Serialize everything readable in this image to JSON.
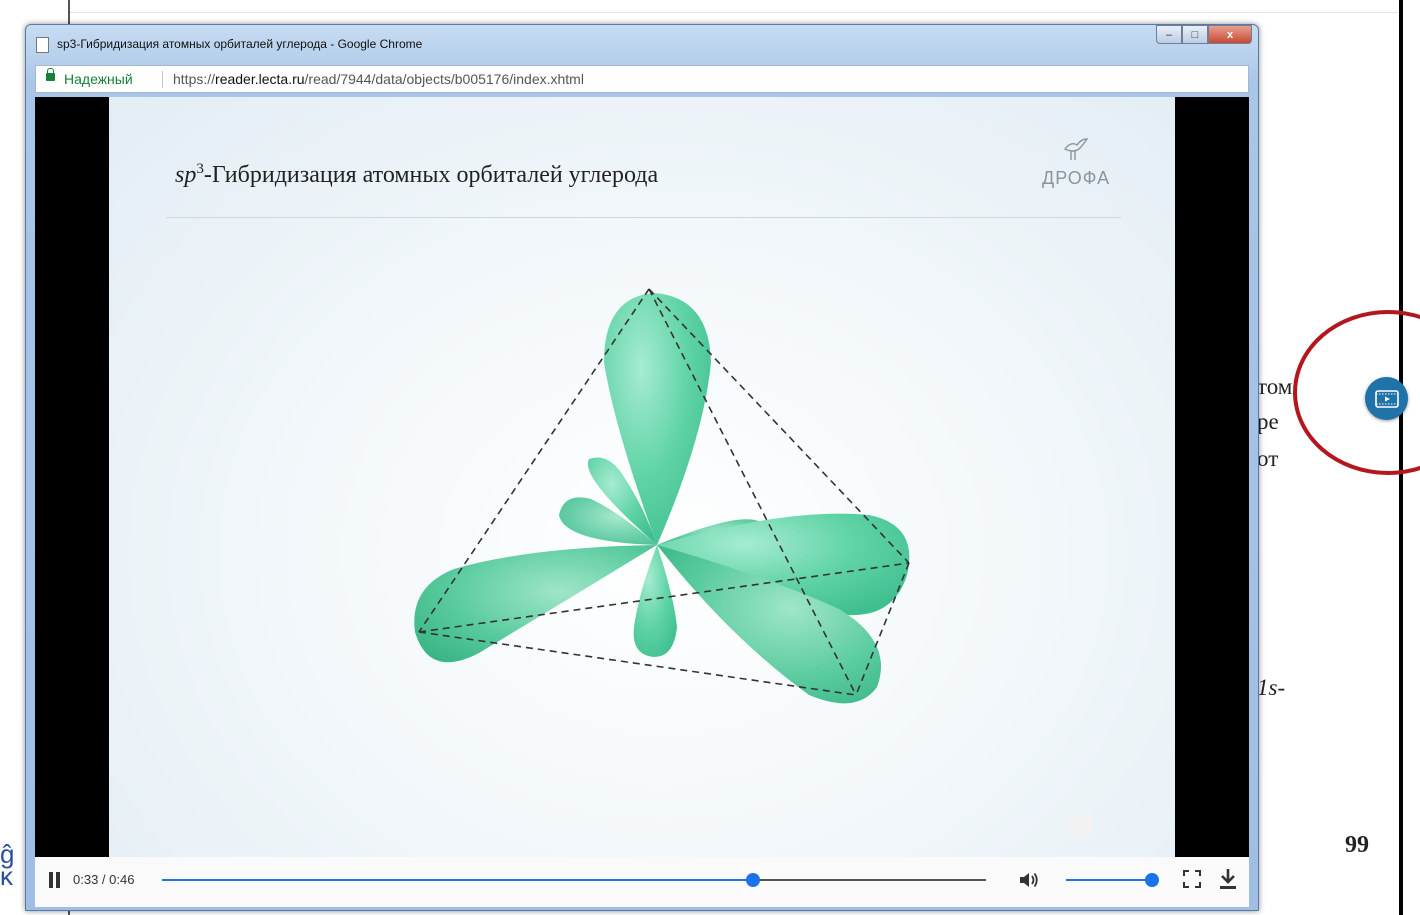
{
  "window": {
    "title": "sp3-Гибридизация атомных орбиталей углерода - Google Chrome",
    "buttons": {
      "minimize": "–",
      "maximize": "□",
      "close": "x"
    }
  },
  "address_bar": {
    "secure_label": "Надежный",
    "url_scheme": "https://",
    "url_host": "reader.lecta.ru",
    "url_path": "/read/7944/data/objects/b005176/index.xhtml"
  },
  "slide": {
    "title_prefix": "sp",
    "title_superscript": "3",
    "title_rest": "-Гибридизация атомных орбиталей углерода",
    "logo_text": "ДРОФА",
    "lobe_color": "#5fd3a6"
  },
  "player": {
    "time_current": "0:33",
    "time_total": "0:46",
    "progress_fraction": 0.7174,
    "volume_fraction": 1.0,
    "accent_color": "#1a73e8",
    "icons": [
      "pause-icon",
      "volume-icon",
      "fullscreen-icon",
      "download-icon"
    ]
  },
  "book_page": {
    "text_fragments": [
      "том",
      "ре",
      "от",
      "1s-"
    ],
    "page_number": "99",
    "edge_glyph": "ĝ\nĸ",
    "video_button_icon": "video-icon",
    "highlight_color": "#b3161c"
  }
}
